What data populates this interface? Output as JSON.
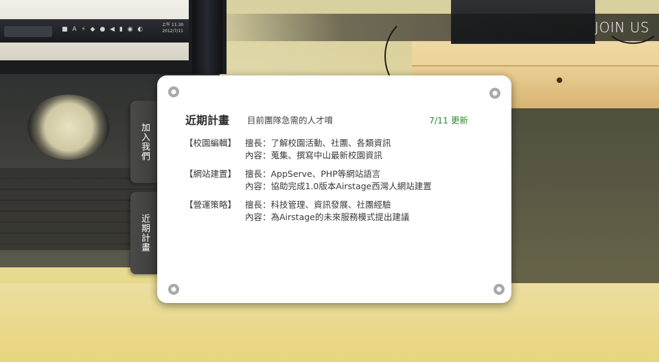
{
  "background": {
    "taskbar_icons": "■ A ⚡ ◆ ● ◀ ▮ ◉ ◐",
    "taskbar_clock_time": "上午 11:30",
    "taskbar_clock_date": "2012/7/11"
  },
  "header": {
    "join_label": "JOIN US"
  },
  "side_tabs": [
    {
      "label": "加入我們"
    },
    {
      "label": "近期計畫"
    }
  ],
  "card": {
    "title": "近期計畫",
    "subtitle": "目前團隊急需的人才唷",
    "updated": "7/11 更新",
    "sections": [
      {
        "tag": "【校園編輯】",
        "line1": "擅長：了解校園活動、社團、各類資訊",
        "line2": "內容：蒐集、撰寫中山最新校園資訊"
      },
      {
        "tag": "【網站建置】",
        "line1": "擅長：AppServe、PHP等網站語言",
        "line2": "內容：協助完成1.0版本Airstage西灣人網站建置"
      },
      {
        "tag": "【營運策略】",
        "line1": "擅長：科技管理、資訊發展、社團經驗",
        "line2": "內容：為Airstage的未來服務模式提出建議"
      }
    ]
  },
  "colors": {
    "card_bg": "#ffffff",
    "updated_text": "#2f8a2f",
    "tab_bg": "#444442"
  }
}
